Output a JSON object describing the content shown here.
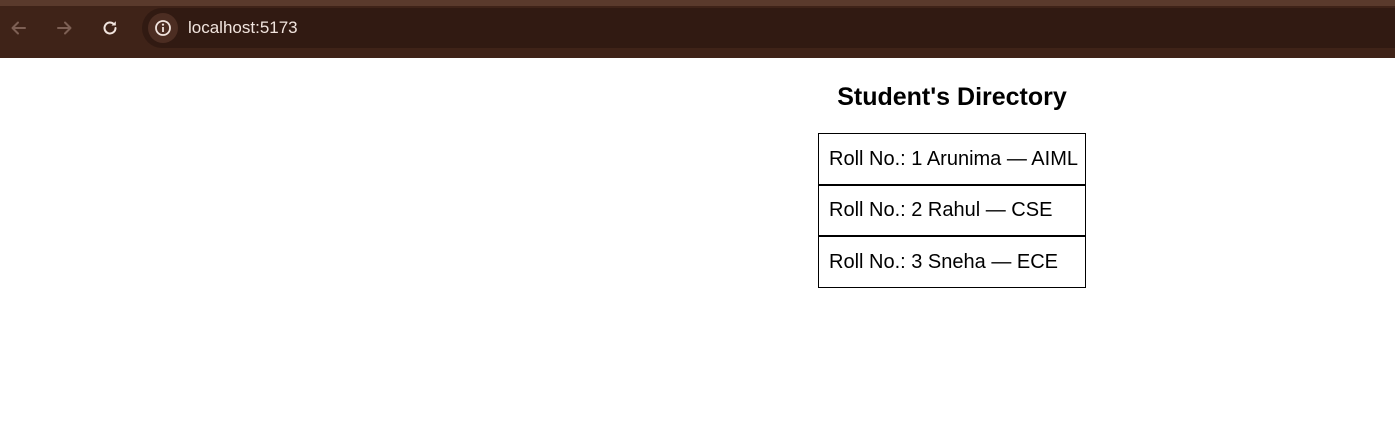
{
  "browser": {
    "url": "localhost:5173",
    "icons": {
      "back": "arrow-left-icon",
      "forward": "arrow-right-icon",
      "reload": "reload-icon",
      "site_info": "info-icon"
    },
    "colors": {
      "toolbar": "#3f2318",
      "omnibox": "#311a12",
      "url_text": "#f1e4de"
    }
  },
  "page": {
    "title": "Student's Directory",
    "students": [
      {
        "text": "Roll No.: 1 Arunima — AIML"
      },
      {
        "text": "Roll No.: 2 Rahul — CSE"
      },
      {
        "text": "Roll No.: 3 Sneha — ECE"
      }
    ]
  }
}
